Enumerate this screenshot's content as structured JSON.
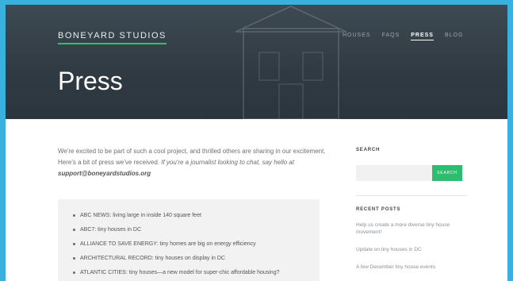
{
  "header": {
    "brand": "BONEYARD STUDIOS",
    "nav": [
      "HOUSES",
      "FAQS",
      "PRESS",
      "BLOG"
    ],
    "active_nav": "PRESS",
    "page_title": "Press"
  },
  "intro": {
    "text": "We're excited to be part of such a cool project, and thrilled others are sharing in our excitement. Here's a bit of press we've received.",
    "journalist": "If you're a journalist looking to chat, say hello at",
    "email": "support@boneyardstudios.org"
  },
  "press_items": [
    {
      "pub": "ABC News",
      "title": ": living large in inside 140 square feet"
    },
    {
      "pub": "ABC7",
      "title": ": tiny houses in DC"
    },
    {
      "pub": "Alliance to Save Energy",
      "title": ": tiny homes are big on energy efficiency"
    },
    {
      "pub": "Architectural Record",
      "title": ": tiny houses on display in DC"
    },
    {
      "pub": "Atlantic Cities",
      "title": ": tiny houses—a new model for super-chic affordable housing?"
    }
  ],
  "sidebar": {
    "search_heading": "SEARCH",
    "search_placeholder": "",
    "search_button": "SEARCH",
    "recent_heading": "RECENT POSTS",
    "recent_posts": [
      "Help us create a more diverse tiny house movement!",
      "Update on tiny houses in DC",
      "A few December tiny house events"
    ]
  },
  "colors": {
    "accent": "#2dbd6e",
    "hero_bg": "#2f3a42",
    "border": "#3ab0df"
  }
}
